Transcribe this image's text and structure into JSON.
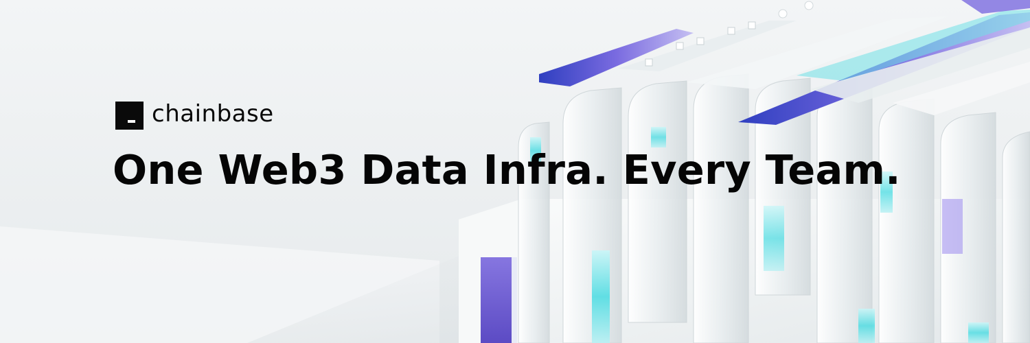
{
  "brand": {
    "name": "chainbase",
    "logo_icon": "chainbase-square-logo-icon"
  },
  "headline": "One Web3 Data Infra. Every Team.",
  "colors": {
    "background": "#eef1f2",
    "text": "#050505",
    "accent_purple": "#6b5bd2",
    "accent_blue": "#2f3fc0",
    "accent_cyan": "#3fd9e0"
  }
}
